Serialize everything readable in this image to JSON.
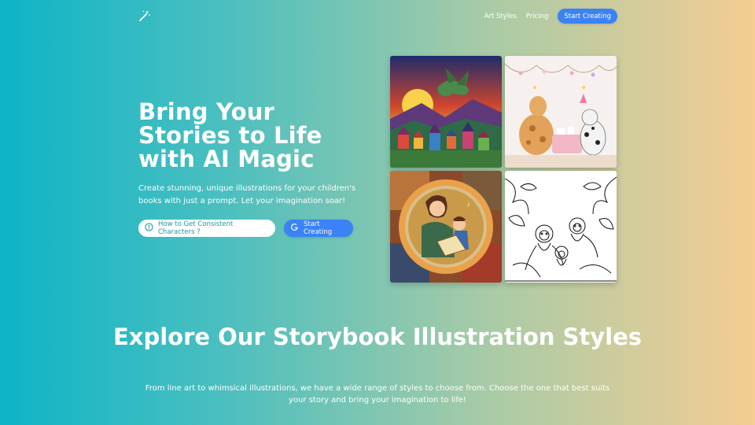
{
  "nav": {
    "logo_icon": "magic-wand-icon",
    "links": [
      "Art Styles",
      "Pricing"
    ],
    "cta_label": "Start Creating"
  },
  "hero": {
    "title_lines": [
      "Bring Your",
      "Stories to Life",
      "with AI Magic"
    ],
    "subtitle": "Create stunning, unique illustrations for your children's books with just a prompt. Let your imagination soar!",
    "secondary_button": {
      "icon": "info-circle-icon",
      "label": "How to Get Consistent Characters ?"
    },
    "primary_button": {
      "icon": "google-icon",
      "label": "Start Creating"
    }
  },
  "gallery": {
    "images": [
      "dragon-village-illustration",
      "giraffe-dog-tea-party-illustration",
      "mother-child-reading-illustration",
      "monkeys-line-art-illustration"
    ]
  },
  "styles_section": {
    "title": "Explore Our Storybook Illustration Styles",
    "subtitle": "From line art to whimsical illustrations, we have a wide range of styles to choose from. Choose the one that best suits your story and bring your imagination to life!"
  },
  "colors": {
    "accent": "#3b82f6",
    "gradient_start": "#0db4c8",
    "gradient_end": "#f5cc92"
  }
}
